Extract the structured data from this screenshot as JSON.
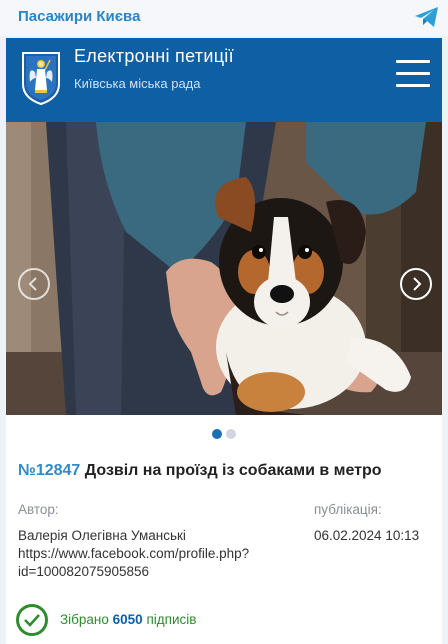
{
  "channel": {
    "title": "Пасажири Києва",
    "icon": "telegram-icon"
  },
  "site": {
    "title": "Електронні петиції",
    "subtitle": "Київська міська рада",
    "logo_icon": "kyiv-crest-icon",
    "menu_icon": "hamburger-menu-icon"
  },
  "carousel": {
    "prev_icon": "chevron-left-icon",
    "next_icon": "chevron-right-icon",
    "slides_total": 2,
    "active_slide": 1
  },
  "petition": {
    "number": "№12847",
    "title": "Дозвіл на проїзд із собаками в метро",
    "author_label": "Автор:",
    "author_name": "Валерія Олегівна Уманські",
    "author_link_1": "https://www.facebook.com/profile.php?",
    "author_link_2": "id=100082075905856",
    "published_label": "публікація:",
    "published_value": "06.02.2024 10:13",
    "signed_prefix": "Зібрано",
    "signed_count": "6050",
    "signed_suffix": "підписів"
  },
  "colors": {
    "brand_blue": "#0f5fa5",
    "link_blue": "#2f8ac9",
    "success_green": "#2e8b2e",
    "dot_active": "#1b6fb8",
    "dot_inactive": "#cfd6de"
  }
}
